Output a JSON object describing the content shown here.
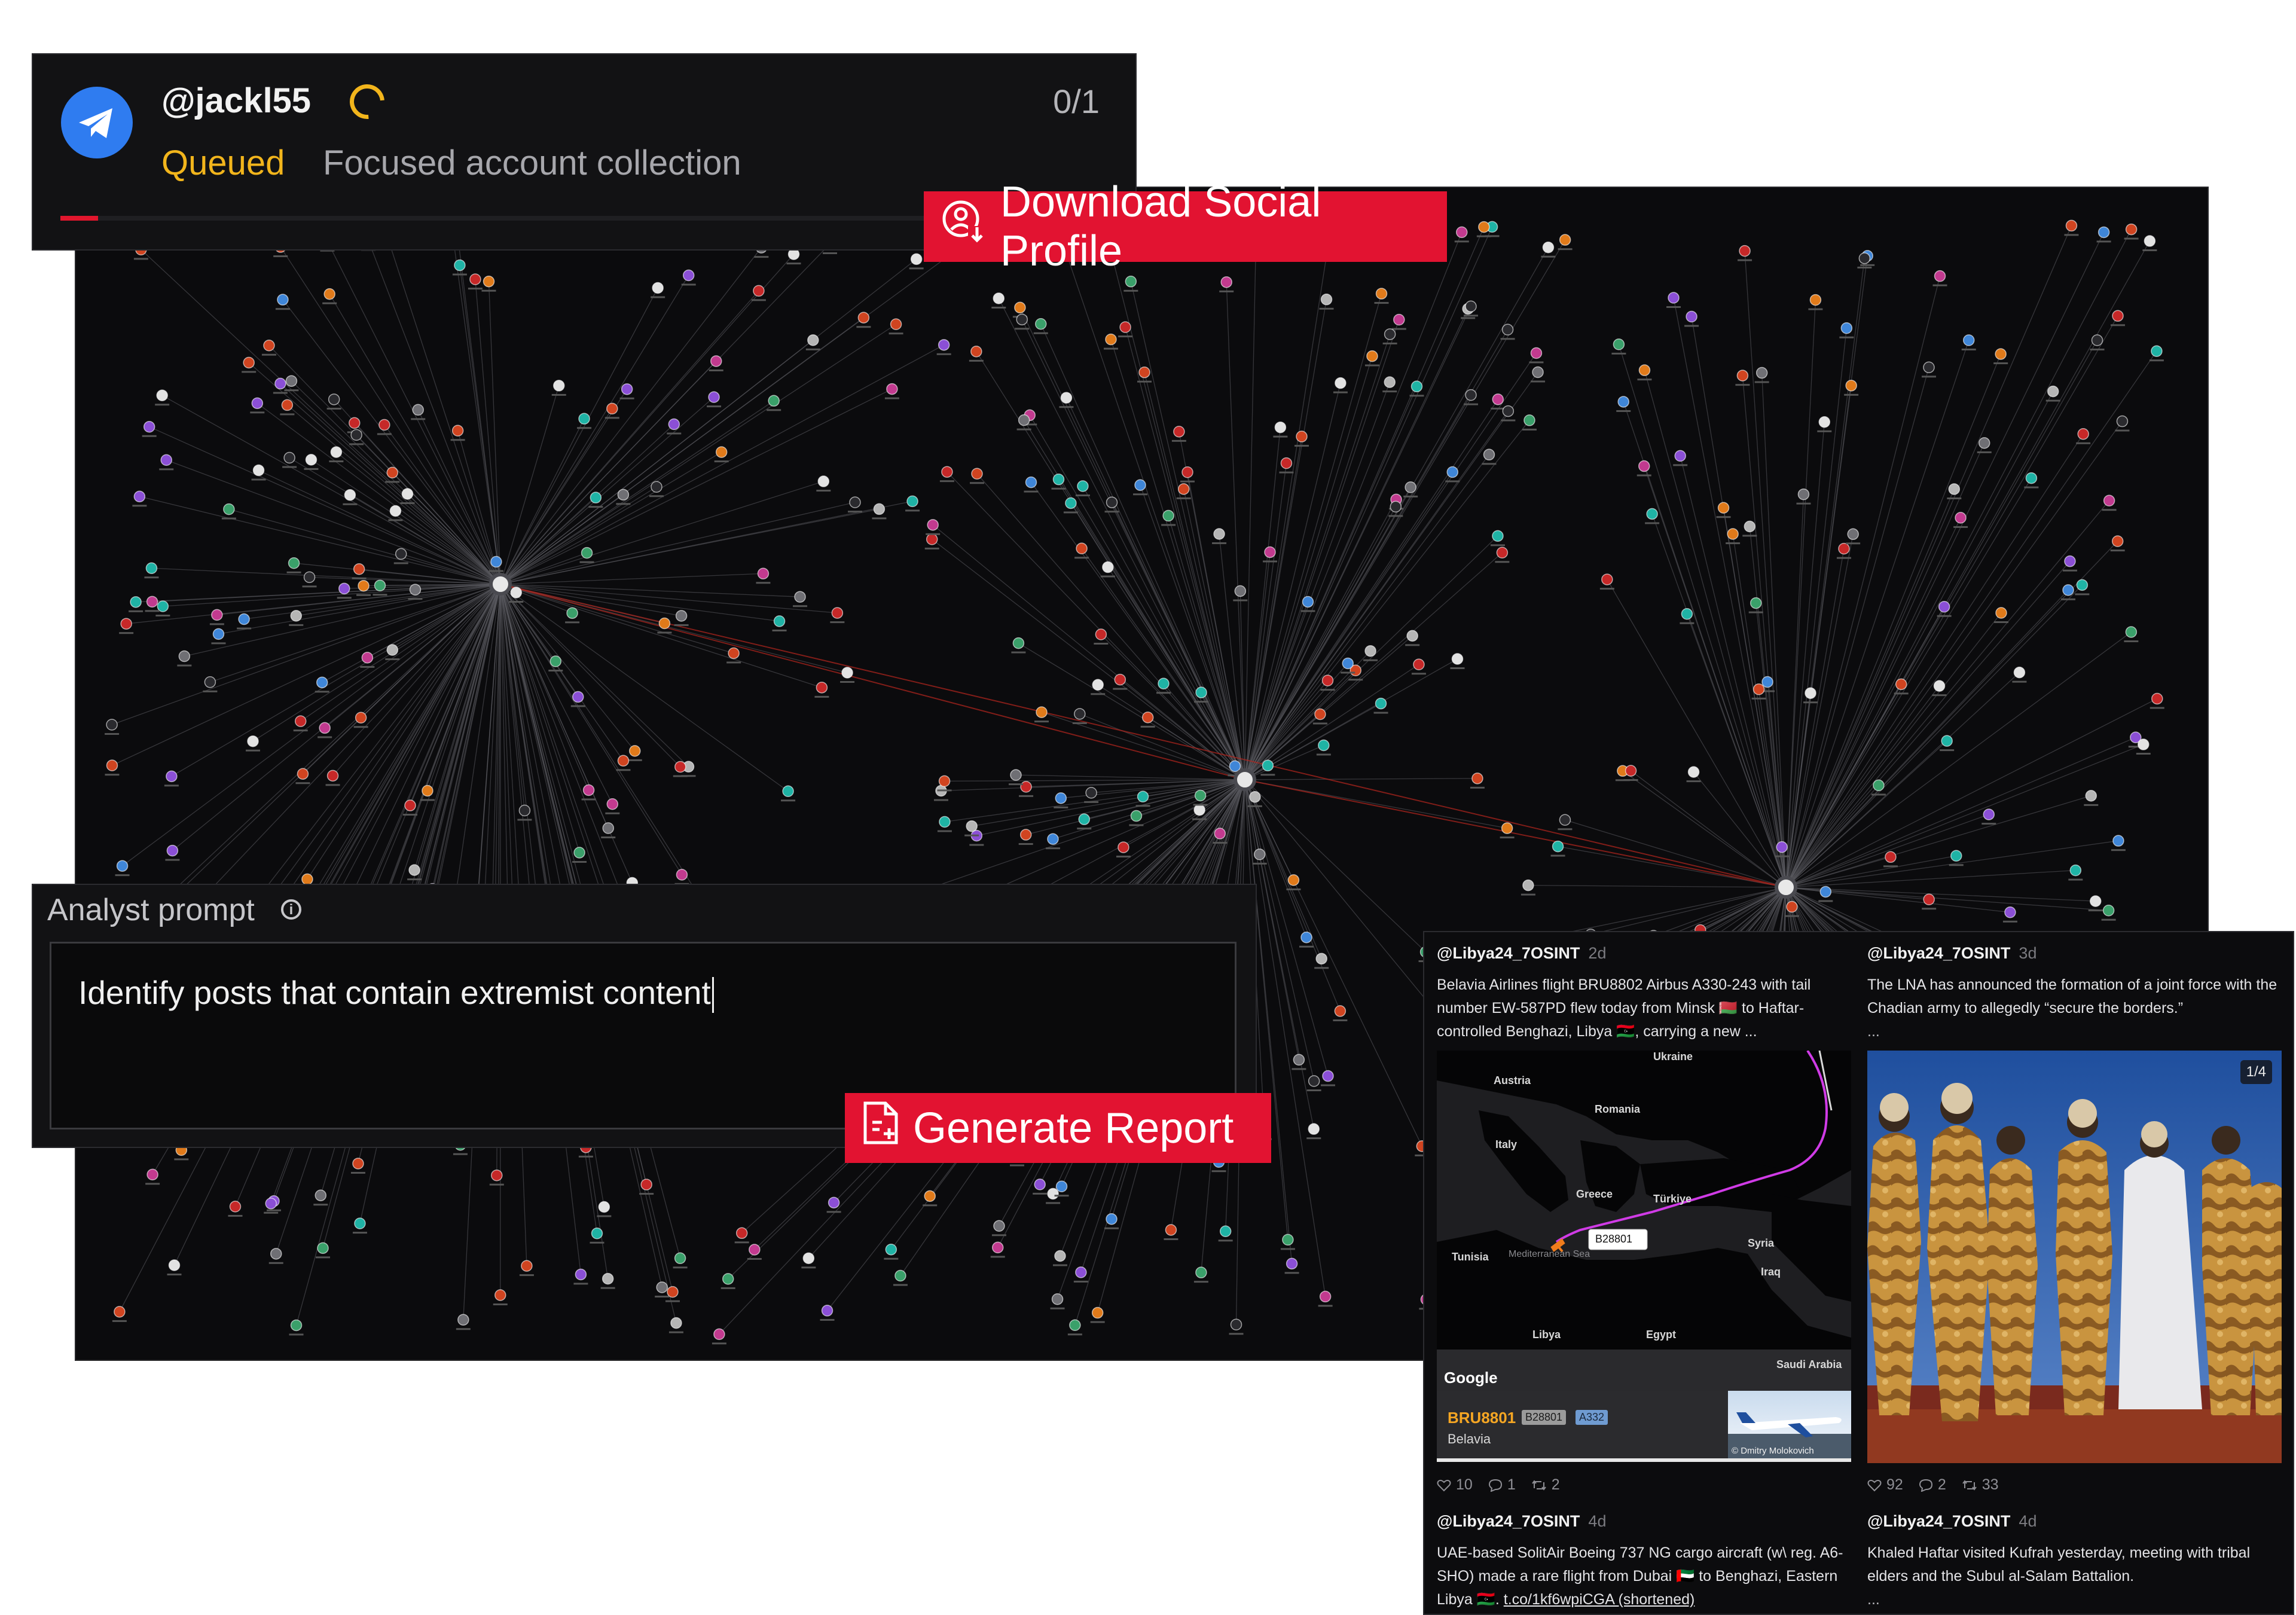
{
  "job": {
    "handle": "@jackl55",
    "count": "0/1",
    "status": "Queued",
    "task": "Focused account collection",
    "progress_fraction": 0.036
  },
  "actions": {
    "download_profile": "Download Social Profile",
    "generate_report": "Generate Report"
  },
  "prompt": {
    "label": "Analyst prompt",
    "text": "Identify posts that contain extremist content"
  },
  "feed": {
    "posts": [
      {
        "author": "@Libya24_7OSINT",
        "age": "2d",
        "text": "Belavia Airlines flight BRU8802 Airbus A330-243 with tail number EW-587PD flew today from Minsk 🇧🇾 to Haftar-controlled Benghazi, Libya 🇱🇾, carrying a new ...",
        "likes": "10",
        "replies": "1",
        "reposts": "2",
        "map": {
          "labels": [
            "Ukraine",
            "Austria",
            "Romania",
            "Italy",
            "Greece",
            "Türkiye",
            "Tunisia",
            "Mediterranean Sea",
            "Syria",
            "Iraq",
            "Libya",
            "Egypt",
            "Saudi Arabia"
          ],
          "flight_label": "B28801",
          "provider": "Google",
          "flight": {
            "callsign": "BRU8801",
            "registration": "B28801",
            "type": "A332",
            "airline": "Belavia",
            "photo_credit": "© Dmitry Molokovich"
          }
        }
      },
      {
        "author": "@Libya24_7OSINT",
        "age": "3d",
        "text": "The LNA has announced the formation of a joint force with the Chadian army to allegedly “secure the borders.”",
        "more": "...",
        "likes": "92",
        "replies": "2",
        "reposts": "33",
        "gallery_index": "1/4"
      },
      {
        "author": "@Libya24_7OSINT",
        "age": "4d",
        "text": "UAE-based SolitAir Boeing 737 NG cargo aircraft (w\\ reg. A6-SHO) made a rare flight from Dubai 🇦🇪 to Benghazi, Eastern Libya 🇱🇾.",
        "link": "t.co/1kf6wpiCGA (shortened)"
      },
      {
        "author": "@Libya24_7OSINT",
        "age": "4d",
        "text": "Khaled Haftar visited Kufrah yesterday, meeting with tribal elders and the Subul al-Salam Battalion.",
        "more": "..."
      }
    ]
  },
  "colors": {
    "accent_red": "#e21331",
    "queued_yellow": "#f2b51c",
    "telegram_blue": "#2f7cf0",
    "flight_path": "#d03be6"
  }
}
